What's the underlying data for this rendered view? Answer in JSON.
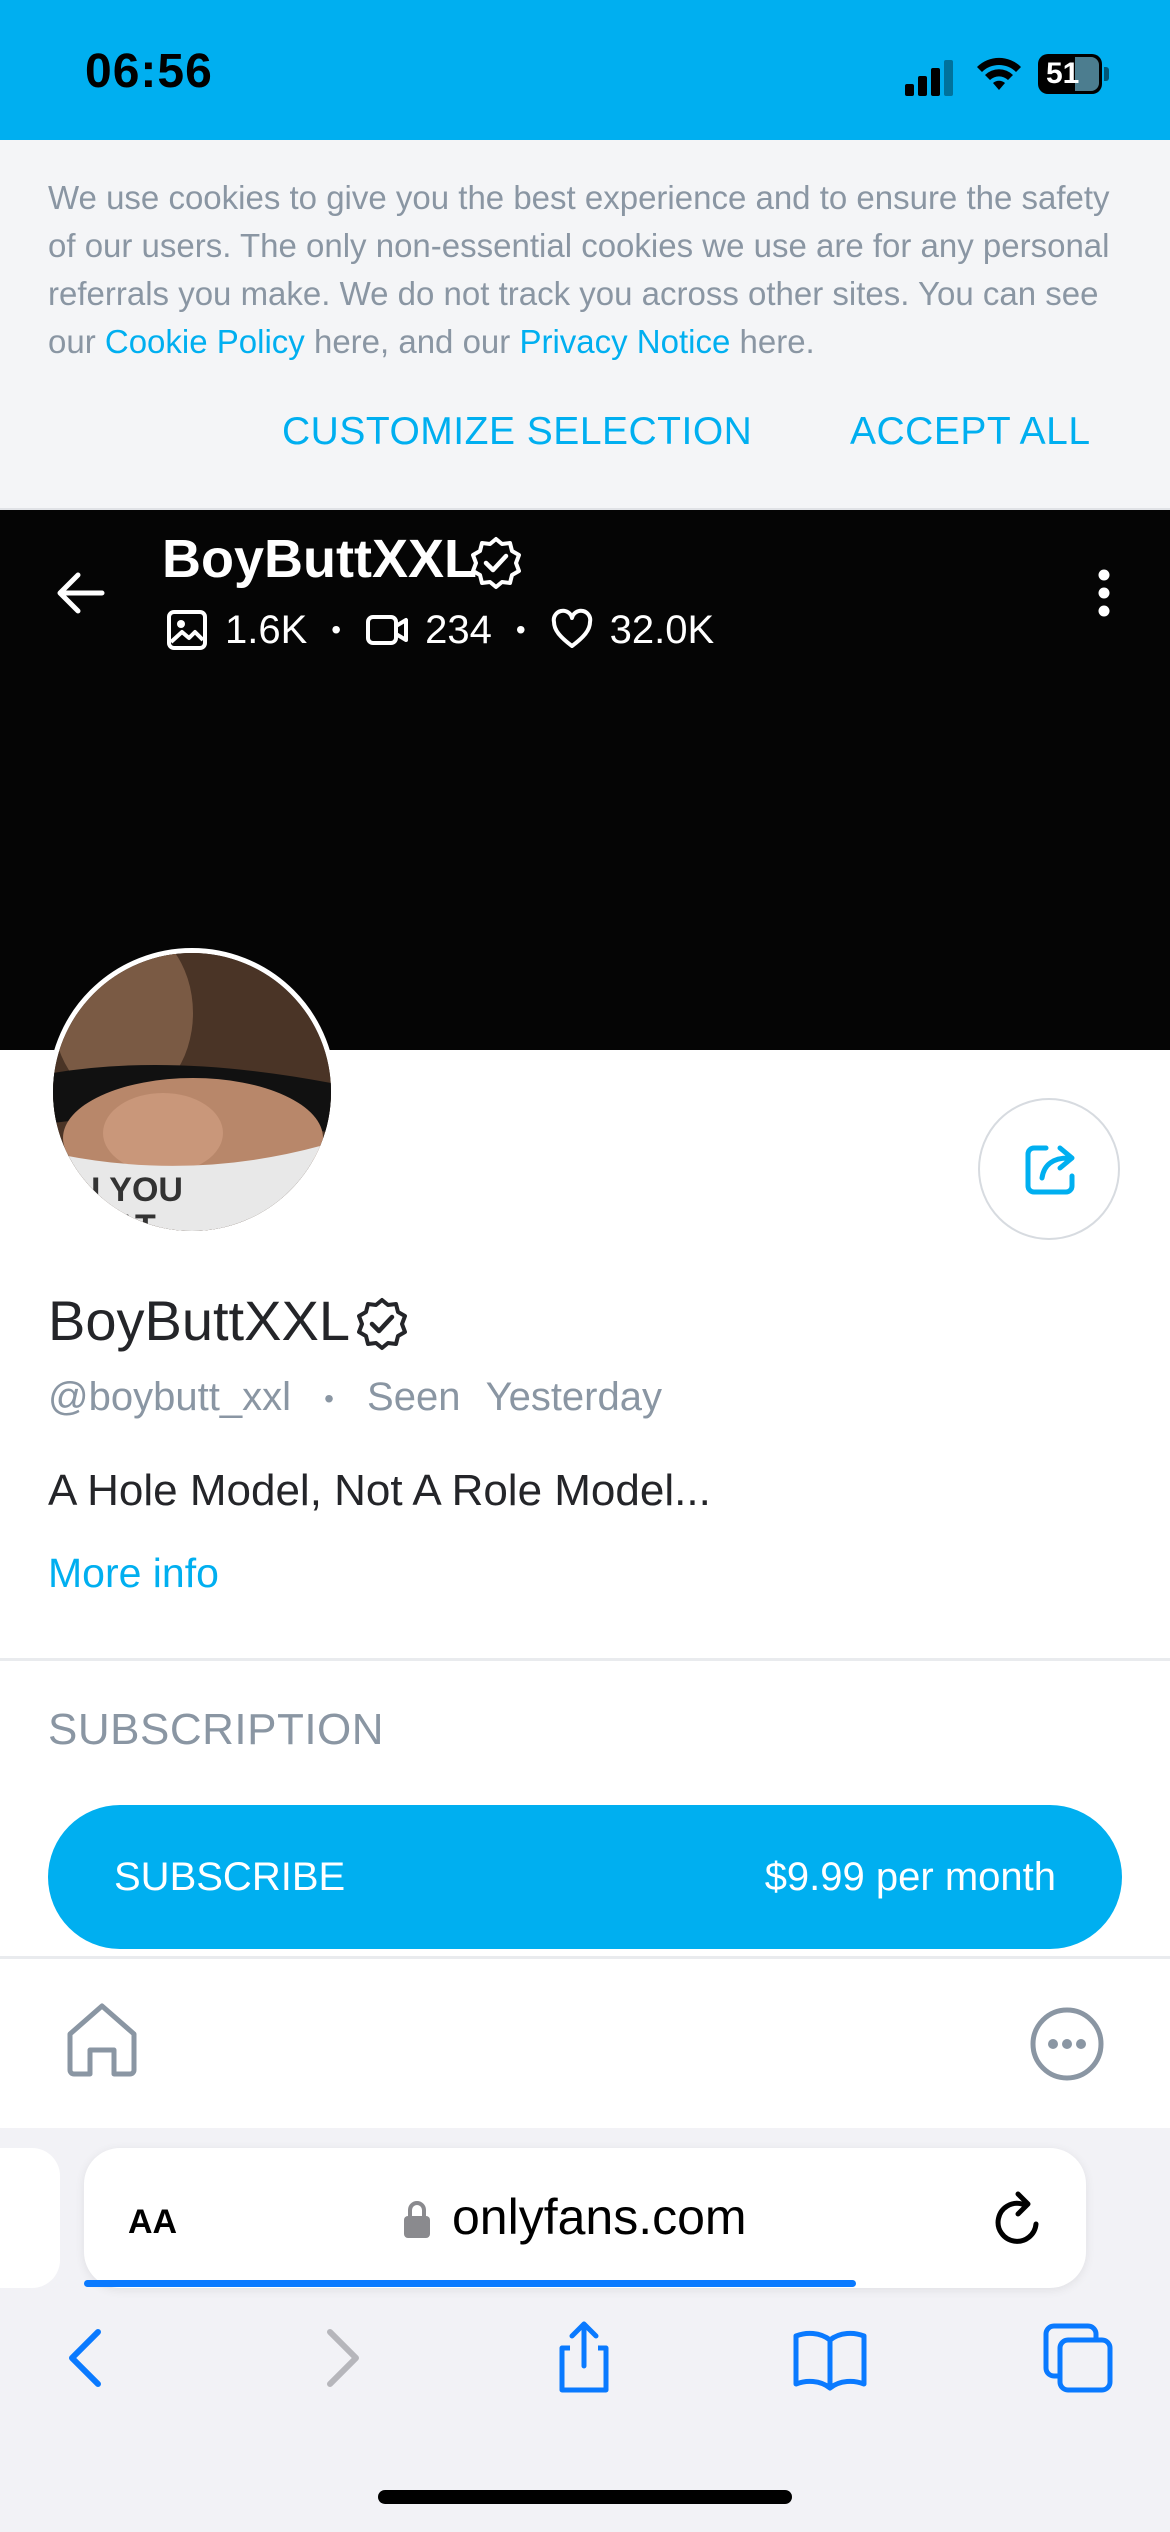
{
  "status_bar": {
    "time": "06:56",
    "battery": "51"
  },
  "cookie_banner": {
    "text_before_cookie": "We use cookies to give you the best experience and to ensure the safety of our users. The only non-essential cookies we use are for any personal referrals you make. We do not track you across other sites. You can see our ",
    "cookie_link": "Cookie Policy",
    "text_middle": " here, and our ",
    "privacy_link": "Privacy Notice",
    "text_after": " here.",
    "customize_label": "CUSTOMIZE SELECTION",
    "accept_label": "ACCEPT ALL"
  },
  "header": {
    "name": "BoyButtXXL",
    "photos": "1.6K",
    "videos": "234",
    "likes": "32.0K",
    "stat_separator": "•"
  },
  "profile": {
    "name": "BoyButtXXL",
    "handle": "@boybutt_xxl",
    "separator": "•",
    "seen_label": "Seen",
    "seen_value": "Yesterday",
    "bio": "A Hole Model, Not A Role Model...",
    "more_info": "More info",
    "avatar_shirt_text": "I YOU",
    "avatar_shirt_text2": "AT"
  },
  "subscription": {
    "title": "SUBSCRIPTION",
    "button_label": "SUBSCRIBE",
    "price": "$9.99 per month"
  },
  "safari": {
    "text_size_label": "AA",
    "url": "onlyfans.com",
    "load_progress": 0.77
  },
  "colors": {
    "brand": "#00aff0",
    "safari_blue": "#0a7aff"
  }
}
